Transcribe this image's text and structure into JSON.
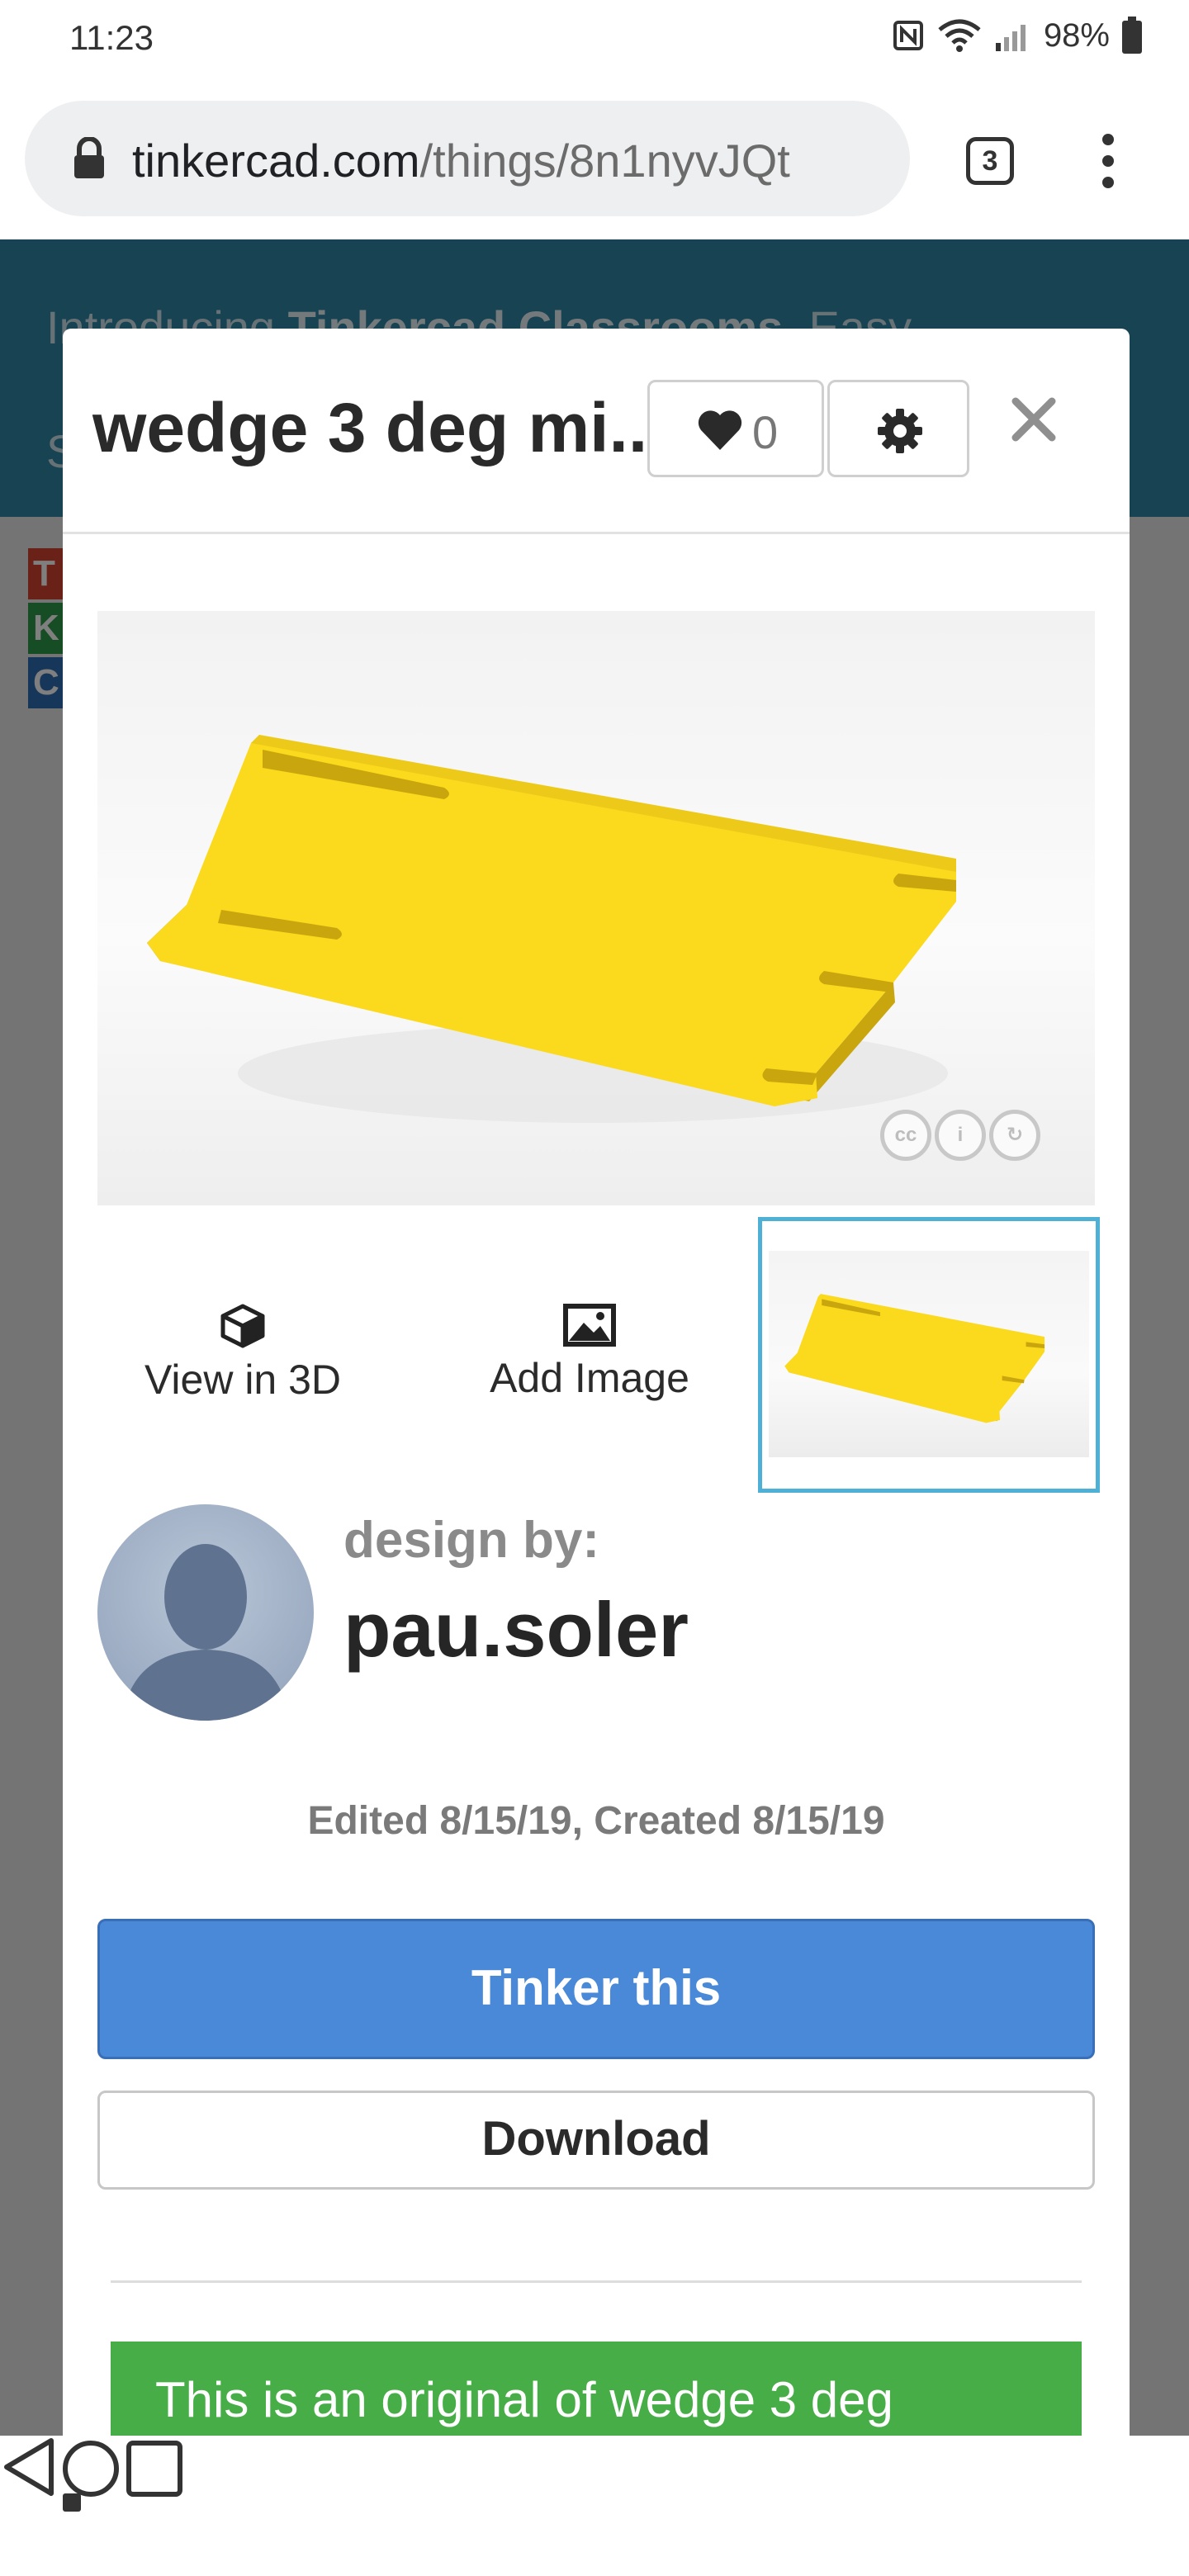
{
  "status_bar": {
    "time": "11:23",
    "battery": "98%",
    "icons": [
      "nfc-icon",
      "wifi-icon",
      "signal-icon",
      "battery-icon"
    ]
  },
  "browser": {
    "url_host": "tinkercad.com",
    "url_path": "/things/8n1nyvJQt",
    "tab_count": "3"
  },
  "background_page": {
    "banner_text_prefix": "Introducing ",
    "banner_text_bold": "Tinkercad Classrooms",
    "banner_text_suffix": ". Easy",
    "banner_text_line2": "S",
    "logo_letters": [
      "T",
      "K",
      "C"
    ],
    "logo_colors": [
      "#d4432f",
      "#2e9a4a",
      "#2d6fb5"
    ]
  },
  "modal": {
    "title": "wedge 3 deg mi...",
    "like_count": "0",
    "actions": {
      "view_3d": "View in 3D",
      "add_image": "Add Image"
    },
    "design_by_label": "design by:",
    "designer_name": "pau.soler",
    "dates": "Edited 8/15/19, Created 8/15/19",
    "tinker_button": "Tinker this",
    "download_button": "Download",
    "original_note": "This is an original of wedge 3 deg",
    "license_icons": [
      "cc-icon",
      "attribution-icon",
      "share-alike-icon"
    ]
  },
  "colors": {
    "primary_button": "#4a89d8",
    "note_green": "#46ad47",
    "banner_blue": "#2f86a6",
    "thumb_border": "#4fb0d5",
    "model_yellow": "#fbd91c"
  }
}
